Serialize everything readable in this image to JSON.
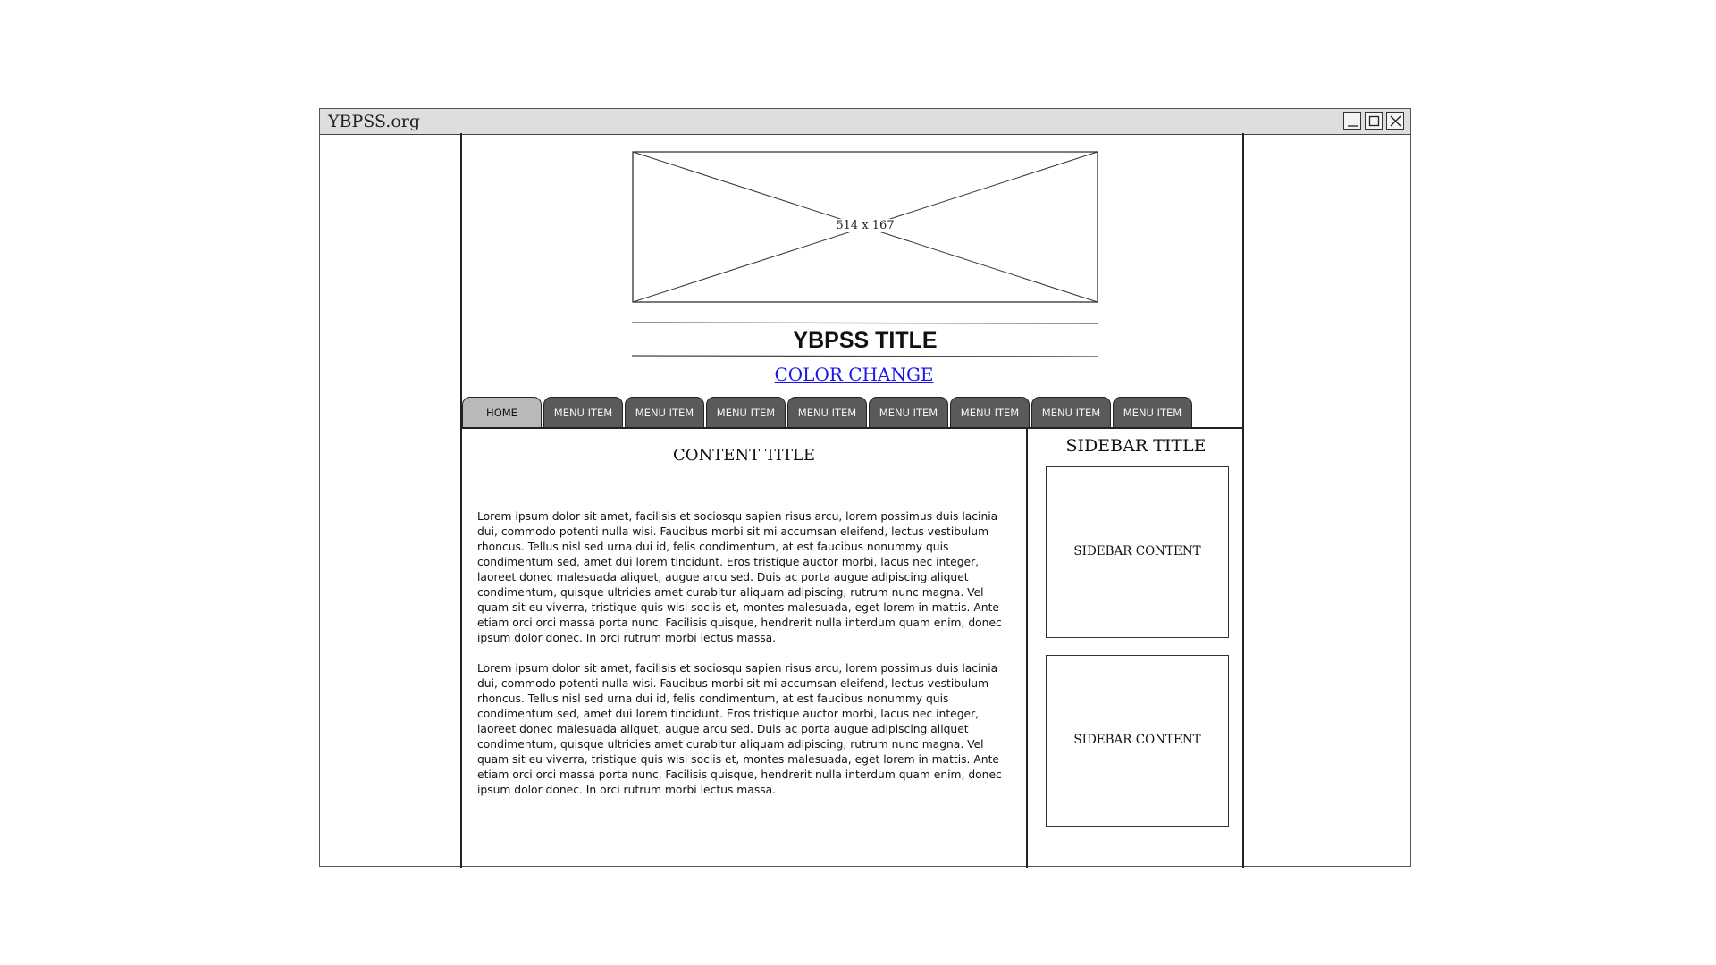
{
  "window": {
    "title": "YBPSS.org",
    "minimize_icon": "minimize-icon",
    "maximize_icon": "maximize-icon",
    "close_icon": "close-icon"
  },
  "header": {
    "banner_placeholder": "514 x 167",
    "site_title": "YBPSS TITLE",
    "color_change_link": "COLOR  CHANGE"
  },
  "nav": {
    "tabs": [
      {
        "label": "HOME",
        "active": true
      },
      {
        "label": "MENU ITEM",
        "active": false
      },
      {
        "label": "MENU ITEM",
        "active": false
      },
      {
        "label": "MENU ITEM",
        "active": false
      },
      {
        "label": "MENU ITEM",
        "active": false
      },
      {
        "label": "MENU ITEM",
        "active": false
      },
      {
        "label": "MENU ITEM",
        "active": false
      },
      {
        "label": "MENU ITEM",
        "active": false
      },
      {
        "label": "MENU ITEM",
        "active": false
      }
    ]
  },
  "content": {
    "title": "CONTENT  TITLE",
    "paragraphs": [
      "Lorem ipsum dolor sit amet, facilisis et sociosqu sapien risus arcu, lorem possimus duis lacinia dui, commodo potenti nulla wisi. Faucibus morbi sit mi accumsan eleifend, lectus vestibulum rhoncus. Tellus nisl sed urna dui id, felis condimentum, at est faucibus nonummy quis condimentum sed, amet dui lorem tincidunt. Eros tristique auctor morbi, lacus nec integer, laoreet donec malesuada aliquet, augue arcu sed. Duis ac porta augue adipiscing aliquet condimentum, quisque ultricies amet curabitur aliquam adipiscing, rutrum nunc magna. Vel quam sit eu viverra, tristique quis wisi sociis et, montes malesuada, eget lorem in mattis. Ante etiam orci orci massa porta nunc. Facilisis quisque, hendrerit nulla interdum quam enim, donec ipsum dolor donec. In orci rutrum morbi lectus massa.",
      "Lorem ipsum dolor sit amet, facilisis et sociosqu sapien risus arcu, lorem possimus duis lacinia dui, commodo potenti nulla wisi. Faucibus morbi sit mi accumsan eleifend, lectus vestibulum rhoncus. Tellus nisl sed urna dui id, felis condimentum, at est faucibus nonummy quis condimentum sed, amet dui lorem tincidunt. Eros tristique auctor morbi, lacus nec integer, laoreet donec malesuada aliquet, augue arcu sed. Duis ac porta augue adipiscing aliquet condimentum, quisque ultricies amet curabitur aliquam adipiscing, rutrum nunc magna. Vel quam sit eu viverra, tristique quis wisi sociis et, montes malesuada, eget lorem in mattis. Ante etiam orci orci massa porta nunc. Facilisis quisque, hendrerit nulla interdum quam enim, donec ipsum dolor donec. In orci rutrum morbi lectus massa."
    ]
  },
  "sidebar": {
    "title": "SIDEBAR  TITLE",
    "boxes": [
      {
        "label": "SIDEBAR CONTENT"
      },
      {
        "label": "SIDEBAR CONTENT"
      }
    ]
  },
  "colors": {
    "link": "#1a17e6",
    "tab_inactive": "#5a5a5a",
    "tab_active": "#b9b9b9",
    "titlebar": "#dedede"
  }
}
